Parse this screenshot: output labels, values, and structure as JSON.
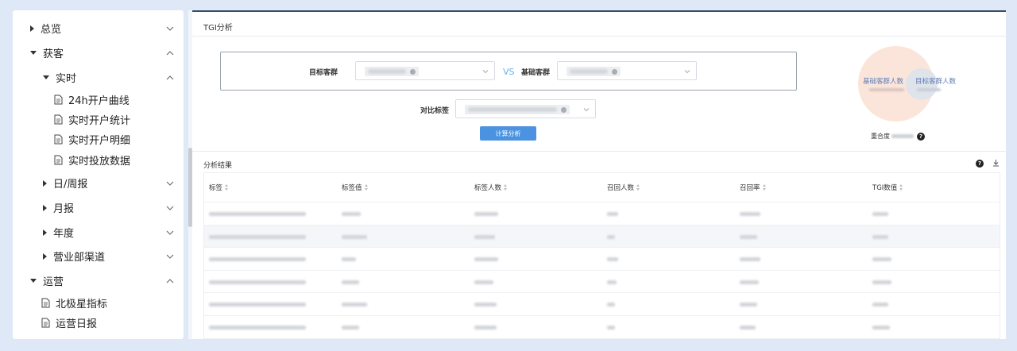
{
  "sidebar": {
    "items": [
      {
        "label": "总览",
        "level": 0,
        "state": "collapsed"
      },
      {
        "label": "获客",
        "level": 0,
        "state": "expanded"
      },
      {
        "label": "实时",
        "level": 1,
        "state": "expanded"
      },
      {
        "label": "24h开户曲线",
        "level": 2,
        "state": "leaf"
      },
      {
        "label": "实时开户统计",
        "level": 2,
        "state": "leaf"
      },
      {
        "label": "实时开户明细",
        "level": 2,
        "state": "leaf"
      },
      {
        "label": "实时投放数据",
        "level": 2,
        "state": "leaf"
      },
      {
        "label": "日/周报",
        "level": 1,
        "state": "collapsed"
      },
      {
        "label": "月报",
        "level": 1,
        "state": "collapsed"
      },
      {
        "label": "年度",
        "level": 1,
        "state": "collapsed"
      },
      {
        "label": "营业部渠道",
        "level": 1,
        "state": "collapsed"
      },
      {
        "label": "运营",
        "level": 0,
        "state": "expanded"
      },
      {
        "label": "北极星指标",
        "level": 1,
        "state": "leaf"
      },
      {
        "label": "运营日报",
        "level": 1,
        "state": "leaf"
      }
    ]
  },
  "tgi": {
    "title": "TGI分析",
    "target_group_label": "目标客群",
    "vs_label": "VS",
    "base_group_label": "基础客群",
    "compare_tag_label": "对比标签",
    "compute_button": "计算分析",
    "venn": {
      "base_label": "基础客群人数",
      "target_label": "目标客群人数",
      "overlap_label": "重合度"
    }
  },
  "results": {
    "title": "分析结果",
    "columns": [
      "标签",
      "标签值",
      "标签人数",
      "召回人数",
      "召回率",
      "TGI数值"
    ],
    "row_count": 6
  },
  "colors": {
    "accent": "#4b93e0",
    "vs": "#6ab0e8",
    "venn_base": "#fbe5da",
    "venn_target": "#dfe3ea"
  }
}
